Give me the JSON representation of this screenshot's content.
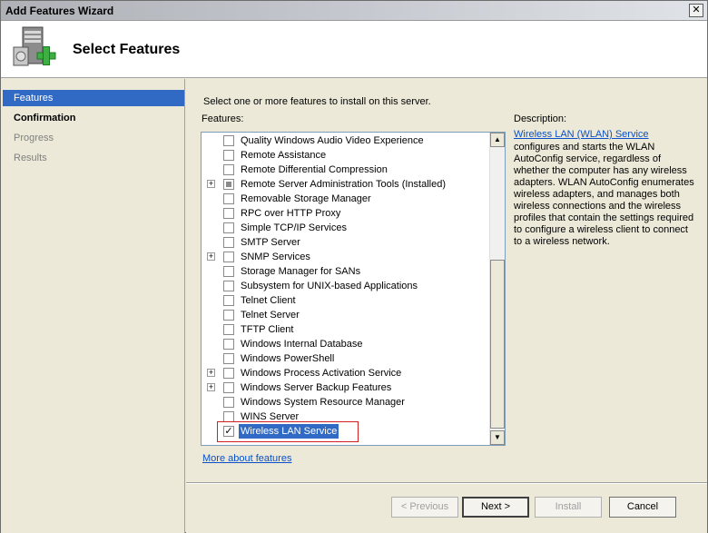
{
  "window": {
    "title": "Add Features Wizard",
    "close_glyph": "✕"
  },
  "header": {
    "title": "Select Features",
    "icon": "server-add-icon"
  },
  "nav": {
    "items": [
      {
        "label": "Features",
        "state": "active"
      },
      {
        "label": "Confirmation",
        "state": "bold"
      },
      {
        "label": "Progress",
        "state": "dim"
      },
      {
        "label": "Results",
        "state": "dim"
      }
    ]
  },
  "main": {
    "instruction": "Select one or more features to install on this server.",
    "features_label": "Features:",
    "features": [
      {
        "label": "Quality Windows Audio Video Experience",
        "expander": false,
        "checked": false
      },
      {
        "label": "Remote Assistance",
        "expander": false,
        "checked": false
      },
      {
        "label": "Remote Differential Compression",
        "expander": false,
        "checked": false
      },
      {
        "label": "Remote Server Administration Tools  (Installed)",
        "expander": true,
        "checked": "partial"
      },
      {
        "label": "Removable Storage Manager",
        "expander": false,
        "checked": false
      },
      {
        "label": "RPC over HTTP Proxy",
        "expander": false,
        "checked": false
      },
      {
        "label": "Simple TCP/IP Services",
        "expander": false,
        "checked": false
      },
      {
        "label": "SMTP Server",
        "expander": false,
        "checked": false
      },
      {
        "label": "SNMP Services",
        "expander": true,
        "checked": false
      },
      {
        "label": "Storage Manager for SANs",
        "expander": false,
        "checked": false
      },
      {
        "label": "Subsystem for UNIX-based Applications",
        "expander": false,
        "checked": false
      },
      {
        "label": "Telnet Client",
        "expander": false,
        "checked": false
      },
      {
        "label": "Telnet Server",
        "expander": false,
        "checked": false
      },
      {
        "label": "TFTP Client",
        "expander": false,
        "checked": false
      },
      {
        "label": "Windows Internal Database",
        "expander": false,
        "checked": false
      },
      {
        "label": "Windows PowerShell",
        "expander": false,
        "checked": false
      },
      {
        "label": "Windows Process Activation Service",
        "expander": true,
        "checked": false
      },
      {
        "label": "Windows Server Backup Features",
        "expander": true,
        "checked": false
      },
      {
        "label": "Windows System Resource Manager",
        "expander": false,
        "checked": false
      },
      {
        "label": "WINS Server",
        "expander": false,
        "checked": false
      },
      {
        "label": "Wireless LAN Service",
        "expander": false,
        "checked": true,
        "selected": true
      }
    ],
    "more_link": "More about features",
    "description_label": "Description:",
    "description_link": "Wireless LAN (WLAN) Service",
    "description_text": "configures and starts the WLAN AutoConfig service, regardless of whether the computer has any wireless adapters. WLAN AutoConfig enumerates wireless adapters, and manages both wireless connections and the wireless profiles that contain the settings required to configure a wireless client to connect to a wireless network."
  },
  "buttons": {
    "previous": "< Previous",
    "next": "Next >",
    "install": "Install",
    "cancel": "Cancel"
  },
  "glyphs": {
    "expander": "+",
    "check": "✓",
    "scroll_up": "▲",
    "scroll_down": "▼"
  },
  "colors": {
    "selection": "#316ac5",
    "link": "#0b50c8",
    "highlight_border": "#d02020"
  }
}
